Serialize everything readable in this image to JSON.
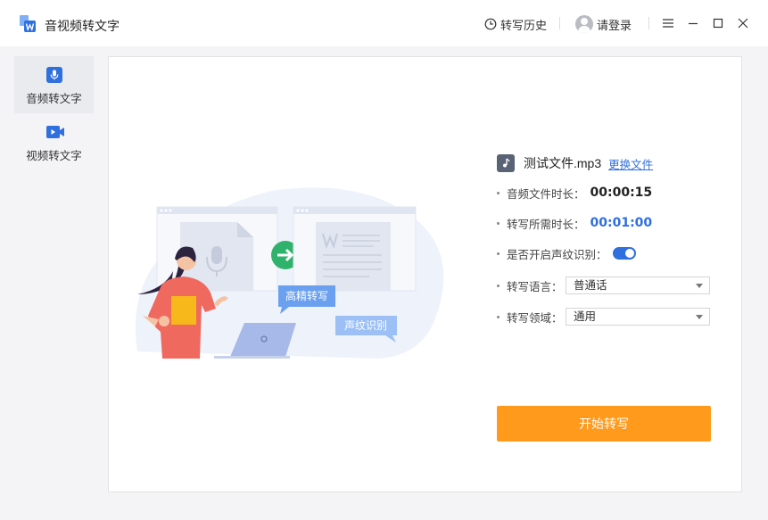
{
  "app": {
    "title": "音视频转文字"
  },
  "header": {
    "history_label": "转写历史",
    "login_label": "请登录"
  },
  "sidebar": {
    "items": [
      {
        "label": "音频转文字",
        "active": true
      },
      {
        "label": "视频转文字",
        "active": false
      }
    ]
  },
  "illustration": {
    "bubble_hd": "高精转写",
    "bubble_voiceprint": "声纹识别"
  },
  "file": {
    "name": "测试文件.mp3",
    "change_label": "更换文件"
  },
  "settings": {
    "duration_label": "音频文件时长：",
    "duration_value": "00:00:15",
    "needed_label": "转写所需时长：",
    "needed_value": "00:01:00",
    "voiceprint_label": "是否开启声纹识别：",
    "voiceprint_enabled": true,
    "language_label": "转写语言：",
    "language_value": "普通话",
    "domain_label": "转写领域：",
    "domain_value": "通用"
  },
  "actions": {
    "start_label": "开始转写"
  },
  "colors": {
    "accent": "#2f6fde",
    "start_button": "#ff9a1c",
    "logo_blue": "#2f6fde"
  }
}
